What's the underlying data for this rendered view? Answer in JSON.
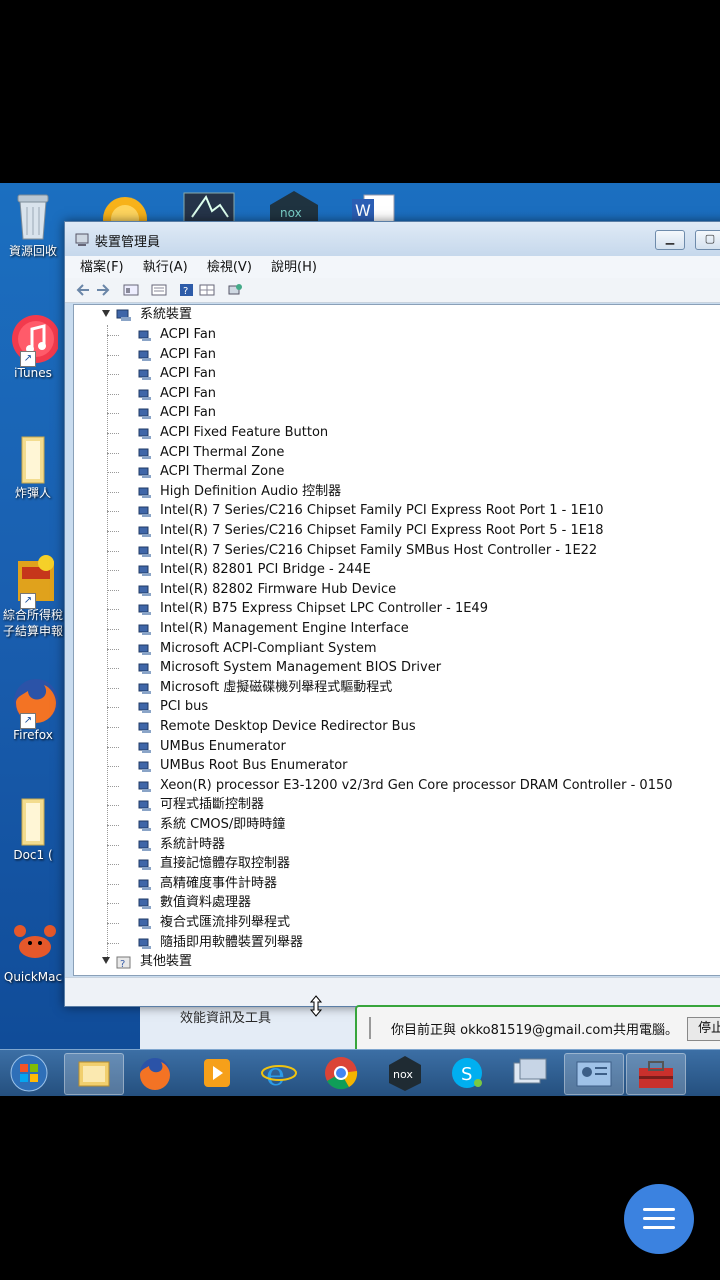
{
  "desktop_icons": [
    {
      "label": "資源回收",
      "icon": "recycle-bin-icon"
    },
    {
      "label": "iTunes",
      "icon": "itunes-icon"
    },
    {
      "label": "炸彈人",
      "icon": "folder-icon"
    },
    {
      "label": "綜合所得稅",
      "label2": "子結算申報",
      "icon": "tax-app-icon"
    },
    {
      "label": "Firefox",
      "icon": "firefox-icon"
    },
    {
      "label": "Doc1  (",
      "icon": "folder-icon"
    },
    {
      "label": "QuickMac",
      "icon": "crab-icon"
    }
  ],
  "window": {
    "title": "裝置管理員",
    "menu": [
      "檔案(F)",
      "執行(A)",
      "檢視(V)",
      "說明(H)"
    ],
    "category": "系統裝置",
    "devices": [
      "ACPI Fan",
      "ACPI Fan",
      "ACPI Fan",
      "ACPI Fan",
      "ACPI Fan",
      "ACPI Fixed Feature Button",
      "ACPI Thermal Zone",
      "ACPI Thermal Zone",
      "High Definition Audio 控制器",
      "Intel(R) 7 Series/C216 Chipset Family PCI Express Root Port 1 - 1E10",
      "Intel(R) 7 Series/C216 Chipset Family PCI Express Root Port 5 - 1E18",
      "Intel(R) 7 Series/C216 Chipset Family SMBus Host Controller - 1E22",
      "Intel(R) 82801 PCI Bridge - 244E",
      "Intel(R) 82802 Firmware Hub Device",
      "Intel(R) B75 Express Chipset LPC Controller - 1E49",
      "Intel(R) Management Engine Interface",
      "Microsoft ACPI-Compliant System",
      "Microsoft System Management BIOS Driver",
      "Microsoft 虛擬磁碟機列舉程式驅動程式",
      "PCI bus",
      "Remote Desktop Device Redirector Bus",
      "UMBus Enumerator",
      "UMBus Root Bus Enumerator",
      "Xeon(R) processor E3-1200 v2/3rd Gen Core processor DRAM Controller - 0150",
      "可程式插斷控制器",
      "系統 CMOS/即時時鐘",
      "系統計時器",
      "直接記憶體存取控制器",
      "高精確度事件計時器",
      "數值資料處理器",
      "複合式匯流排列舉程式",
      "隨插即用軟體裝置列舉器"
    ],
    "next_category": "其他裝置"
  },
  "behind_window_text": "效能資訊及工具",
  "notification": {
    "text": "你目前正與 okko81519@gmail.com共用電腦。",
    "stop_label": "停止"
  },
  "taskbar": [
    "start",
    "explorer",
    "firefox",
    "media",
    "ie",
    "chrome",
    "nox",
    "skype",
    "remote",
    "control",
    "toolbox"
  ],
  "colors": {
    "desktop": "#1a5fb0",
    "notify_border": "#37a53c",
    "fab": "#3b82e0"
  }
}
